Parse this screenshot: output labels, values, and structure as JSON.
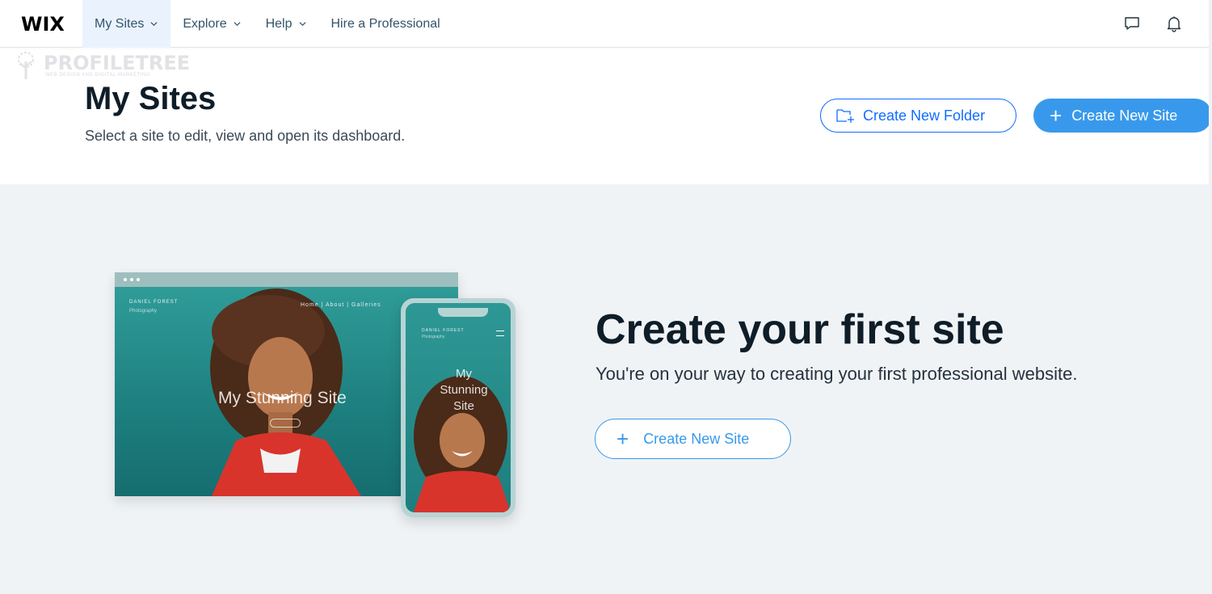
{
  "brand": {
    "logo": "WIX"
  },
  "nav": {
    "items": [
      {
        "label": "My Sites",
        "active": true,
        "has_dropdown": true
      },
      {
        "label": "Explore",
        "active": false,
        "has_dropdown": true
      },
      {
        "label": "Help",
        "active": false,
        "has_dropdown": true
      },
      {
        "label": "Hire a Professional",
        "active": false,
        "has_dropdown": false
      }
    ],
    "icons": [
      "chat-icon",
      "bell-icon"
    ]
  },
  "watermark": {
    "text": "PROFILETREE",
    "sub": "WEB DESIGN AND DIGITAL MARKETING"
  },
  "header": {
    "title": "My Sites",
    "subtitle": "Select a site to edit, view and open its dashboard.",
    "create_folder_label": "Create New Folder",
    "create_site_label": "Create New Site"
  },
  "illustration": {
    "site_brand": "DANIEL FOREST",
    "site_brand_sub": "Photography",
    "site_menu": "Home  |  About  |  Galleries",
    "site_title": "My Stunning Site",
    "phone_title": "My Stunning Site"
  },
  "empty_state": {
    "title": "Create your first site",
    "subtitle": "You're on your way to creating your first professional website.",
    "button_label": "Create New Site"
  },
  "colors": {
    "accent": "#3899ec",
    "accent_dark": "#116dff",
    "page_bg": "#f0f3f6",
    "title": "#0e1d28"
  }
}
